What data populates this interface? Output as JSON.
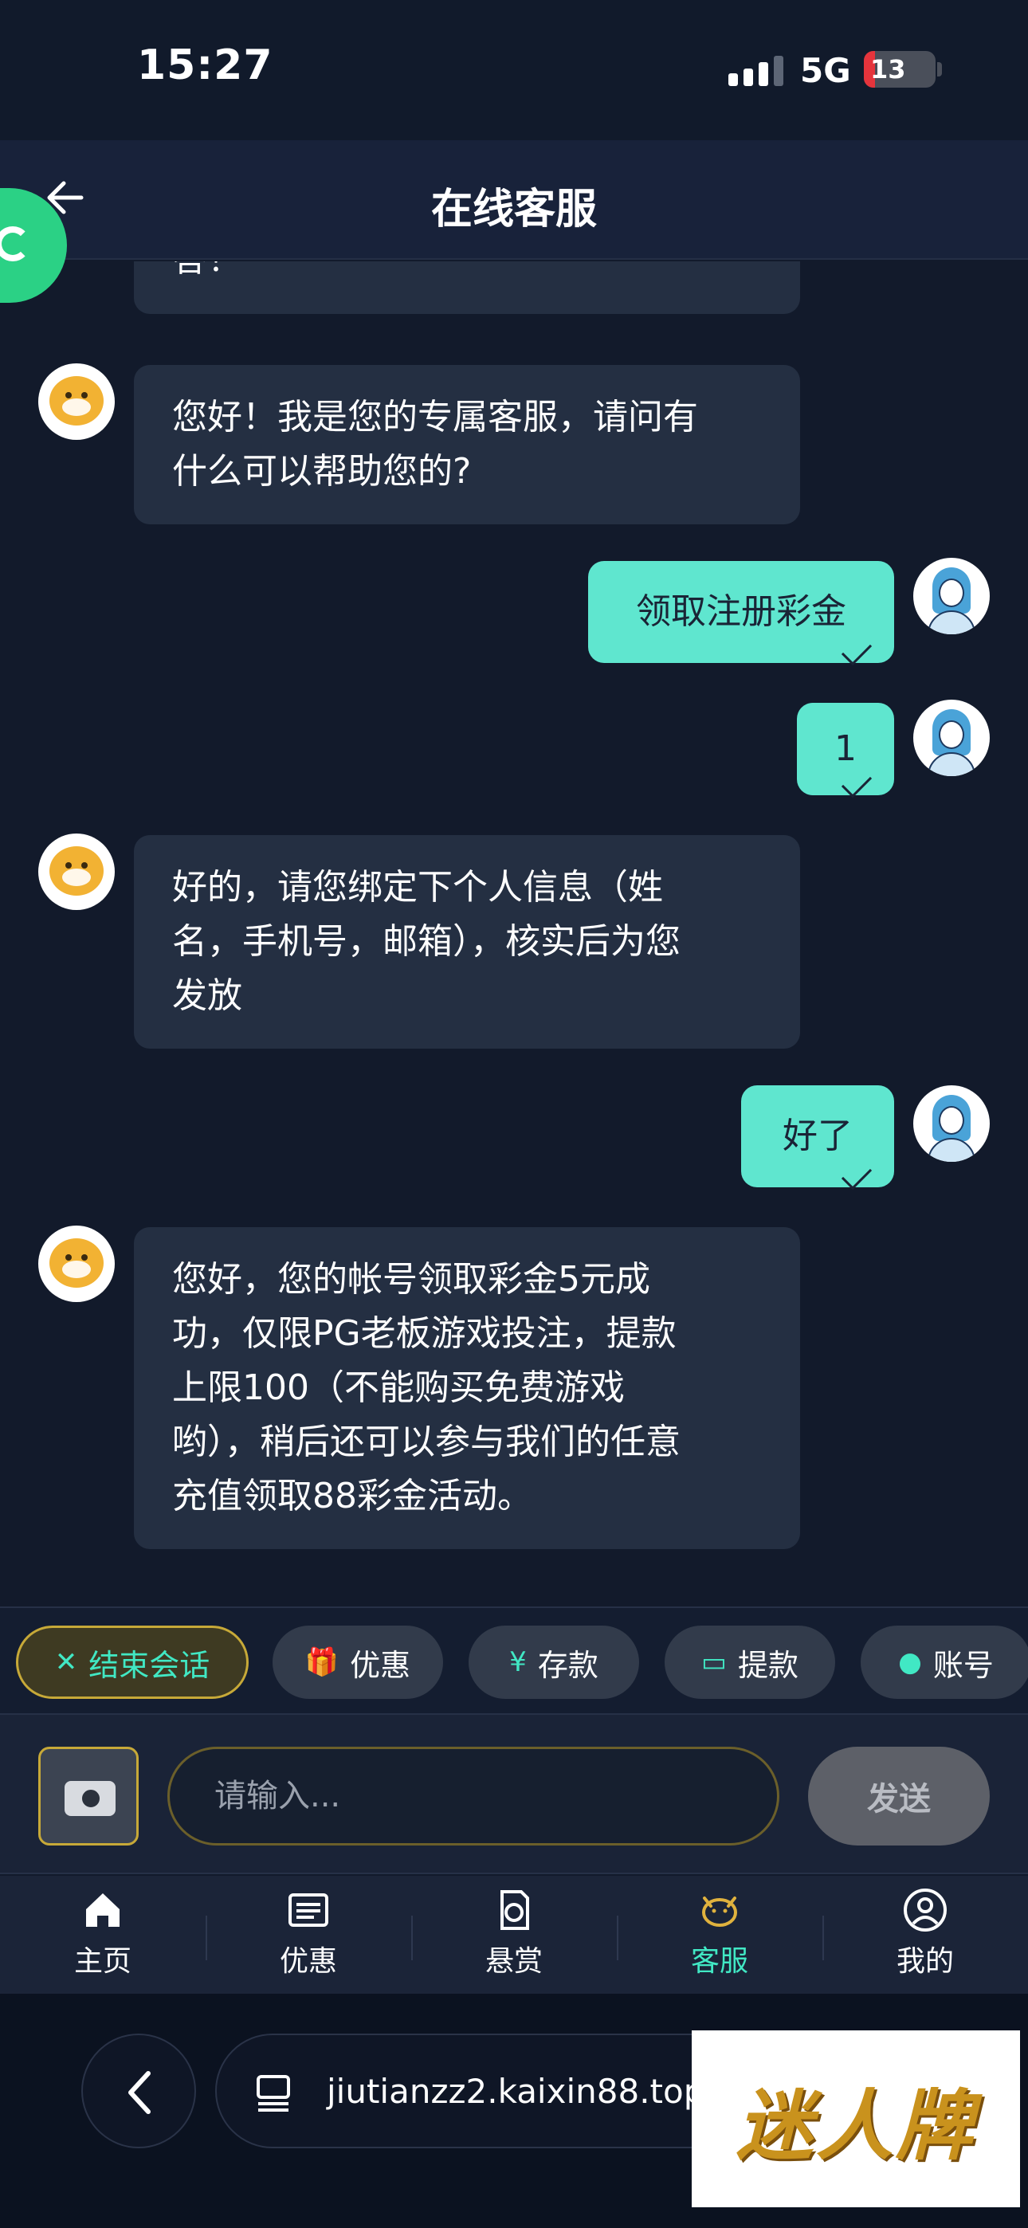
{
  "status_bar": {
    "time": "15:27",
    "network": "5G",
    "battery": "13"
  },
  "header": {
    "title": "在线客服"
  },
  "messages": {
    "partial": "答！",
    "m1": {
      "line1": "您好！我是您的专属客服，请问有",
      "line2": "什么可以帮助您的?"
    },
    "u1": "领取注册彩金",
    "u2": "1",
    "m2": {
      "line1": "好的，请您绑定下个人信息（姓",
      "line2": "名，手机号，邮箱），核实后为您",
      "line3": "发放"
    },
    "u3": "好了",
    "m3": {
      "line1": "您好，您的帐号领取彩金5元成",
      "line2": "功，仅限PG老板游戏投注，提款",
      "line3": "上限100（不能购买免费游戏",
      "line4": "哟），稍后还可以参与我们的任意",
      "line5": "充值领取88彩金活动。"
    }
  },
  "quick_actions": {
    "end": "结束会话",
    "promo": "优惠",
    "deposit": "存款",
    "withdraw": "提款",
    "account": "账号"
  },
  "input": {
    "placeholder": "请输入...",
    "send": "发送"
  },
  "tabs": {
    "home": "主页",
    "promo": "优惠",
    "reward": "悬赏",
    "service": "客服",
    "mine": "我的"
  },
  "browser": {
    "url": "jiutianzz2.kaixin88.top"
  },
  "watermark": "迷人牌",
  "colors": {
    "accent": "#41e8c4",
    "user_bubble": "#5fe6cf",
    "background": "#121a2b"
  }
}
